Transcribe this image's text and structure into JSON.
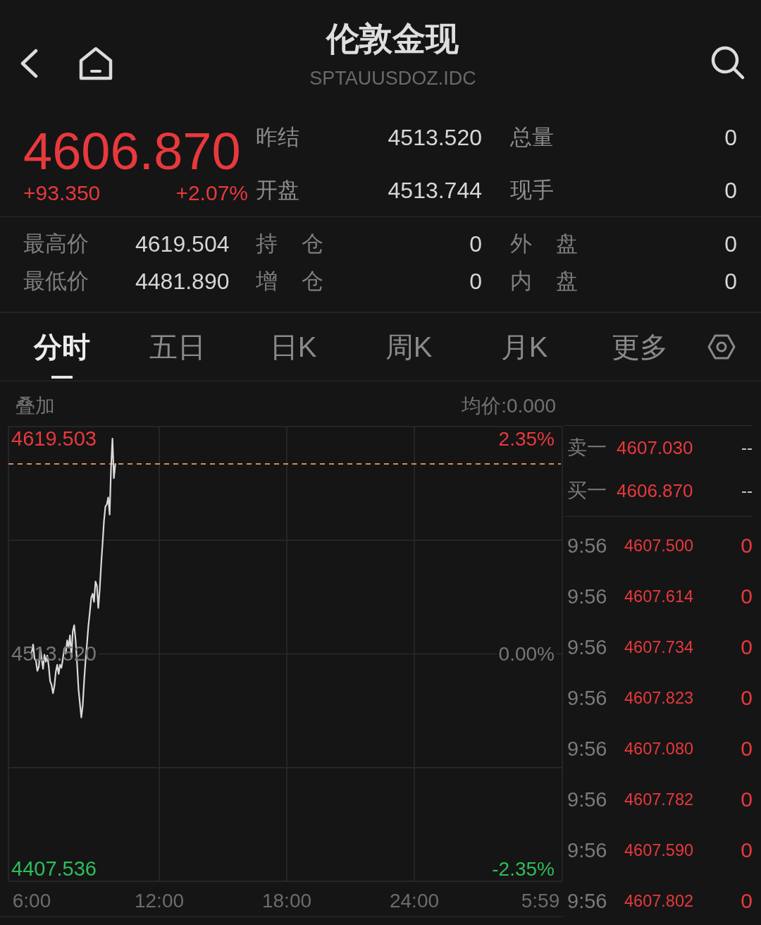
{
  "header": {
    "title": "伦敦金现",
    "subtitle": "SPTAUUSDOZ.IDC"
  },
  "quote": {
    "price": "4606.870",
    "change": "+93.350",
    "change_percent": "+2.07%",
    "fields": [
      {
        "label": "昨结",
        "value": "4513.520"
      },
      {
        "label": "总量",
        "value": "0"
      },
      {
        "label": "开盘",
        "value": "4513.744"
      },
      {
        "label": "现手",
        "value": "0"
      }
    ]
  },
  "stats": [
    {
      "label": "最高价",
      "value": "4619.504"
    },
    {
      "label": "持 仓",
      "value": "0"
    },
    {
      "label": "外 盘",
      "value": "0"
    },
    {
      "label": "最低价",
      "value": "4481.890"
    },
    {
      "label": "增 仓",
      "value": "0"
    },
    {
      "label": "内 盘",
      "value": "0"
    }
  ],
  "tabs": [
    {
      "label": "分时",
      "selected": true
    },
    {
      "label": "五日",
      "selected": false
    },
    {
      "label": "日K",
      "selected": false
    },
    {
      "label": "周K",
      "selected": false
    },
    {
      "label": "月K",
      "selected": false
    },
    {
      "label": "更多",
      "selected": false
    }
  ],
  "chart": {
    "overlay_label": "叠加",
    "average_price": "均价:0.000",
    "right_labels": [
      "2.35%",
      "0.00%",
      "-2.35%"
    ],
    "chart_data": {
      "type": "line",
      "categories": [
        "6:00",
        null,
        null,
        null,
        null,
        null,
        null,
        null,
        null,
        null,
        null,
        null,
        null,
        null,
        null,
        null,
        null,
        null,
        null,
        null,
        null,
        null,
        null,
        null,
        null,
        null,
        null,
        null,
        null,
        null,
        null,
        null,
        null,
        null,
        null,
        null,
        null,
        null,
        null,
        null,
        null,
        null,
        null,
        null,
        null,
        null,
        null,
        null,
        null,
        null,
        null,
        null,
        null,
        null,
        null,
        null,
        null,
        null,
        null,
        null,
        null,
        null,
        null,
        null,
        null,
        null,
        null,
        null,
        null,
        null,
        null,
        null,
        null,
        null,
        null,
        null,
        null,
        null,
        null,
        null,
        null,
        null,
        null,
        null,
        null,
        null,
        null,
        null,
        null,
        null,
        "12:00",
        null,
        null,
        null,
        null,
        null,
        null,
        null,
        null,
        null,
        null,
        null,
        null,
        null,
        null,
        null,
        null,
        null,
        null,
        null,
        null,
        null,
        null,
        null,
        null,
        null,
        null,
        null,
        null,
        null,
        null,
        null,
        null,
        null,
        null,
        null,
        null,
        null,
        null,
        null,
        null,
        null,
        null,
        null,
        null,
        null,
        null,
        null,
        null,
        null,
        null,
        null,
        null,
        null,
        null,
        null,
        null,
        null,
        null,
        null,
        null,
        null,
        null,
        null,
        null,
        null,
        null,
        null,
        null,
        null,
        null,
        null,
        null,
        null,
        null,
        null,
        null,
        null,
        null,
        null,
        null,
        null,
        null,
        null,
        null,
        null,
        null,
        null,
        null,
        null,
        "18:00",
        null,
        null,
        null,
        null,
        null,
        null,
        null,
        null,
        null,
        null,
        null,
        null,
        null,
        null,
        null,
        null,
        null,
        null,
        null,
        null,
        null,
        null,
        null,
        null,
        null,
        null,
        null,
        null,
        null,
        null,
        null,
        null,
        null,
        null,
        null,
        null,
        null,
        null,
        null,
        null,
        null,
        null,
        null,
        null,
        null,
        null,
        null,
        null,
        null,
        null,
        null,
        null,
        null,
        null,
        null,
        null,
        null,
        null,
        null,
        null,
        null,
        null,
        null,
        null,
        null,
        null,
        null,
        null,
        null,
        null,
        null,
        null,
        null,
        null,
        null,
        null,
        null,
        null,
        null,
        null,
        null,
        null,
        null,
        null,
        null,
        null,
        null,
        null,
        null,
        "24:00",
        null,
        null,
        null,
        null,
        null,
        null,
        null,
        null,
        null,
        null,
        null,
        null,
        null,
        null,
        null,
        null,
        null,
        null,
        null,
        null,
        null,
        null,
        null,
        null,
        null,
        null,
        null,
        null,
        null,
        null,
        null,
        null,
        null,
        null,
        null,
        null,
        null,
        null,
        null,
        null,
        null,
        null,
        null,
        null,
        null,
        null,
        null,
        null,
        null,
        null,
        null,
        null,
        null,
        null,
        null,
        null,
        null,
        null,
        null,
        null,
        null,
        null,
        null,
        null,
        null,
        null,
        null,
        null,
        null,
        null,
        null,
        null,
        null,
        null,
        null,
        null,
        null,
        null,
        null,
        null,
        null,
        null,
        null,
        null,
        null,
        null,
        null,
        null,
        "5:59"
      ],
      "values": [
        4514,
        4518,
        4511,
        4510,
        4505,
        4507,
        4516.5,
        4511,
        4506,
        4513,
        4509.5,
        4512.5,
        4507.5,
        4500,
        4498,
        4494,
        4497.5,
        4504.5,
        4508,
        4503.5,
        4508,
        4506.5,
        4511,
        4516,
        4513.5,
        4520,
        4516.5,
        4522.5,
        4512,
        4524.5,
        4527.5,
        4520,
        4508.5,
        4496,
        4489,
        4482,
        4488,
        4500,
        4510,
        4518,
        4527,
        4534,
        4541,
        4543,
        4539,
        4549,
        4547,
        4536,
        4545,
        4557,
        4568,
        4579,
        4586,
        4587,
        4590.5,
        4582,
        4605,
        4619.5,
        4600,
        4607,
        null,
        null,
        null,
        null,
        null,
        null,
        null,
        null,
        null,
        null,
        null,
        null,
        null,
        null,
        null,
        null,
        null,
        null,
        null,
        null,
        null,
        null,
        null,
        null,
        null,
        null,
        null,
        null,
        null,
        null,
        null,
        null,
        null,
        null,
        null,
        null,
        null,
        null,
        null,
        null,
        null,
        null,
        null,
        null,
        null,
        null,
        null,
        null,
        null,
        null,
        null,
        null,
        null,
        null,
        null,
        null,
        null,
        null,
        null,
        null,
        null,
        null,
        null,
        null,
        null,
        null,
        null,
        null,
        null,
        null,
        null,
        null,
        null,
        null,
        null,
        null,
        null,
        null,
        null,
        null,
        null,
        null,
        null,
        null,
        null,
        null,
        null,
        null,
        null,
        null,
        null,
        null,
        null,
        null,
        null,
        null,
        null,
        null,
        null,
        null,
        null,
        null,
        null,
        null,
        null,
        null,
        null,
        null,
        null,
        null,
        null,
        null,
        null,
        null,
        null,
        null,
        null,
        null,
        null,
        null,
        null,
        null,
        null,
        null,
        null,
        null,
        null,
        null,
        null,
        null,
        null,
        null,
        null,
        null,
        null,
        null,
        null,
        null,
        null,
        null,
        null,
        null,
        null,
        null,
        null,
        null,
        null,
        null,
        null,
        null,
        null,
        null,
        null,
        null,
        null,
        null,
        null,
        null,
        null,
        null,
        null,
        null,
        null,
        null,
        null,
        null,
        null,
        null,
        null,
        null,
        null,
        null,
        null,
        null,
        null,
        null,
        null,
        null,
        null,
        null,
        null,
        null,
        null,
        null,
        null,
        null,
        null,
        null,
        null,
        null,
        null,
        null,
        null,
        null,
        null,
        null,
        null,
        null,
        null,
        null,
        null,
        null,
        null,
        null,
        null,
        null,
        null,
        null,
        null,
        null,
        null,
        null,
        null,
        null,
        null,
        null,
        null,
        null,
        null,
        null,
        null,
        null,
        null,
        null,
        null,
        null,
        null,
        null,
        null,
        null,
        null,
        null,
        null,
        null,
        null,
        null,
        null,
        null,
        null,
        null,
        null,
        null,
        null,
        null,
        null,
        null,
        null,
        null,
        null,
        null,
        null,
        null,
        null,
        null,
        null,
        null,
        null,
        null,
        null,
        null,
        null,
        null,
        null,
        null,
        null,
        null,
        null,
        null,
        null,
        null,
        null,
        null,
        null,
        null,
        null,
        null,
        null,
        null,
        null,
        null,
        null,
        null,
        null,
        null,
        null,
        null,
        null,
        null,
        null,
        null,
        null,
        null,
        null,
        null,
        null,
        null,
        null,
        null,
        null,
        null
      ],
      "ylim": [
        4407.536,
        4619.503
      ],
      "yticks": [
        4619.503,
        {
          "value": 4513.52,
          "label": "4513.520"
        },
        4407.536
      ],
      "ref_lines": [
        {
          "axis": "y",
          "value": 4607
        }
      ]
    }
  },
  "order_book": [
    {
      "label": "卖一",
      "price": "4607.030",
      "volume": "--"
    },
    {
      "label": "买一",
      "price": "4606.870",
      "volume": "--"
    }
  ],
  "trades": [
    {
      "time": "9:56",
      "price": "4607.500",
      "volume": "0"
    },
    {
      "time": "9:56",
      "price": "4607.614",
      "volume": "0"
    },
    {
      "time": "9:56",
      "price": "4607.734",
      "volume": "0"
    },
    {
      "time": "9:56",
      "price": "4607.823",
      "volume": "0"
    },
    {
      "time": "9:56",
      "price": "4607.080",
      "volume": "0"
    },
    {
      "time": "9:56",
      "price": "4607.782",
      "volume": "0"
    },
    {
      "time": "9:56",
      "price": "4607.590",
      "volume": "0"
    },
    {
      "time": "9:56",
      "price": "4607.802",
      "volume": "0"
    }
  ]
}
